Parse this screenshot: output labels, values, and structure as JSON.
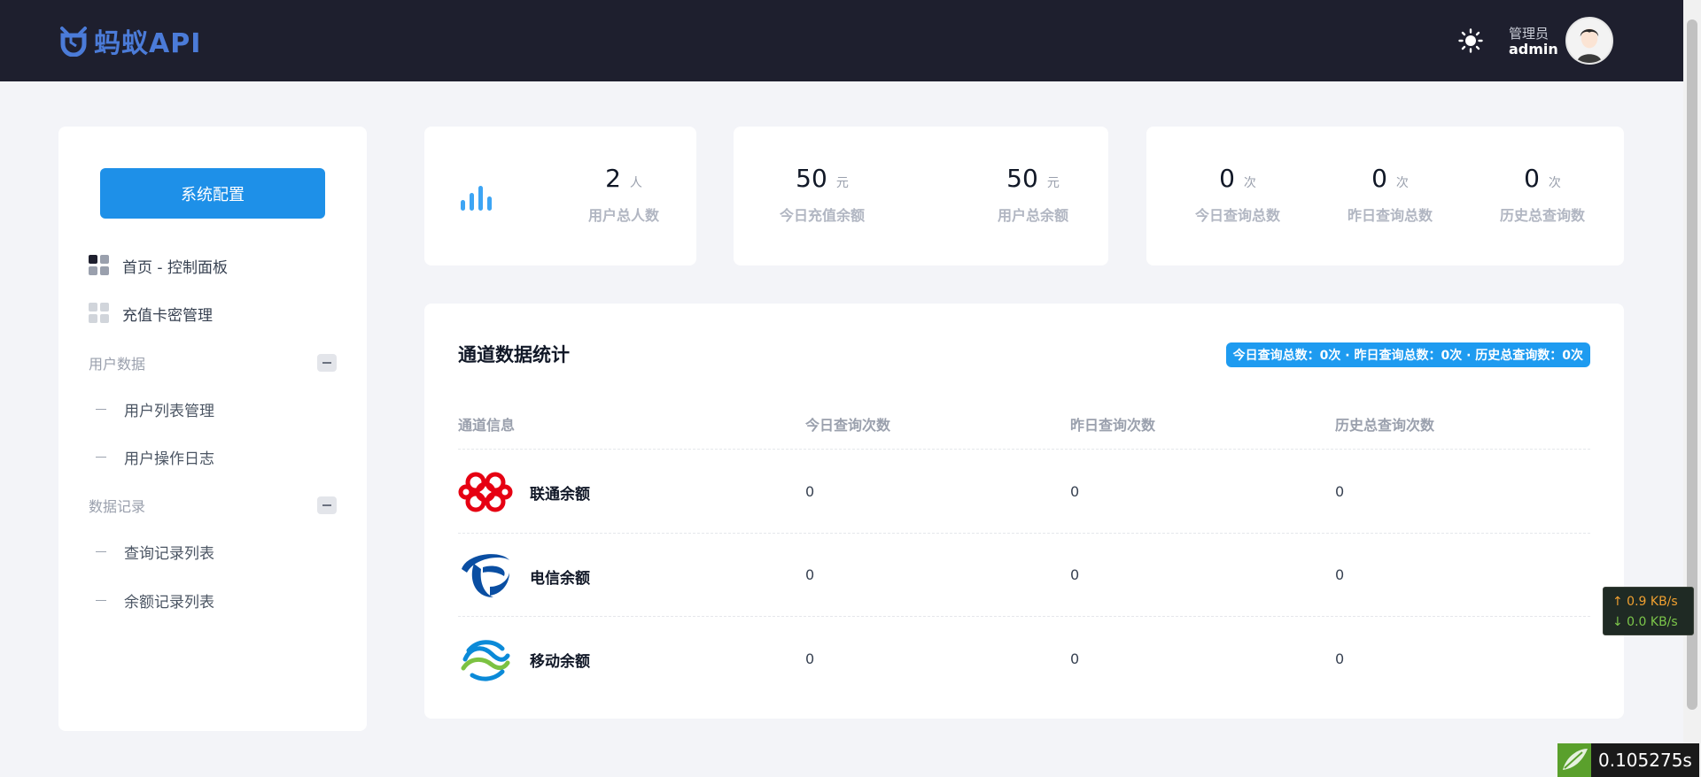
{
  "header": {
    "logo_text": "蚂蚁API",
    "user_role": "管理员",
    "user_name": "admin",
    "icons": {
      "theme": "sun-icon",
      "avatar": "user-avatar"
    }
  },
  "sidebar": {
    "config_button": "系统配置",
    "items": [
      {
        "label": "首页 - 控制面板",
        "icon": "dashboard-grid-icon",
        "active": true
      },
      {
        "label": "充值卡密管理",
        "icon": "dashboard-grid-icon",
        "active": false
      }
    ],
    "groups": [
      {
        "label": "用户数据",
        "children": [
          "用户列表管理",
          "用户操作日志"
        ]
      },
      {
        "label": "数据记录",
        "children": [
          "查询记录列表",
          "余额记录列表"
        ]
      }
    ]
  },
  "stats": {
    "users": {
      "value": "2",
      "unit": "人",
      "label": "用户总人数",
      "icon": "bar-chart-icon"
    },
    "today_recharge": {
      "value": "50",
      "unit": "元",
      "label": "今日充值余额"
    },
    "user_balance": {
      "value": "50",
      "unit": "元",
      "label": "用户总余额"
    },
    "today_queries": {
      "value": "0",
      "unit": "次",
      "label": "今日查询总数"
    },
    "yesterday_queries": {
      "value": "0",
      "unit": "次",
      "label": "昨日查询总数"
    },
    "history_queries": {
      "value": "0",
      "unit": "次",
      "label": "历史总查询数"
    }
  },
  "channel_stats": {
    "title": "通道数据统计",
    "badge": "今日查询总数：0次 · 昨日查询总数：0次 · 历史总查询数：0次",
    "columns": [
      "通道信息",
      "今日查询次数",
      "昨日查询次数",
      "历史总查询次数"
    ],
    "rows": [
      {
        "name": "联通余额",
        "logo": "china-unicom-logo",
        "today": "0",
        "yesterday": "0",
        "history": "0"
      },
      {
        "name": "电信余额",
        "logo": "china-telecom-logo",
        "today": "0",
        "yesterday": "0",
        "history": "0"
      },
      {
        "name": "移动余额",
        "logo": "china-mobile-logo",
        "today": "0",
        "yesterday": "0",
        "history": "0"
      }
    ]
  },
  "network": {
    "upload": "↑ 0.9 KB/s",
    "download": "↓ 0.0 KB/s"
  },
  "timer": {
    "value": "0.105275s"
  },
  "colors": {
    "header_bg": "#1e1f2e",
    "accent": "#1e90e8",
    "badge": "#1e9bf0",
    "logo": "#4b7bd8"
  }
}
